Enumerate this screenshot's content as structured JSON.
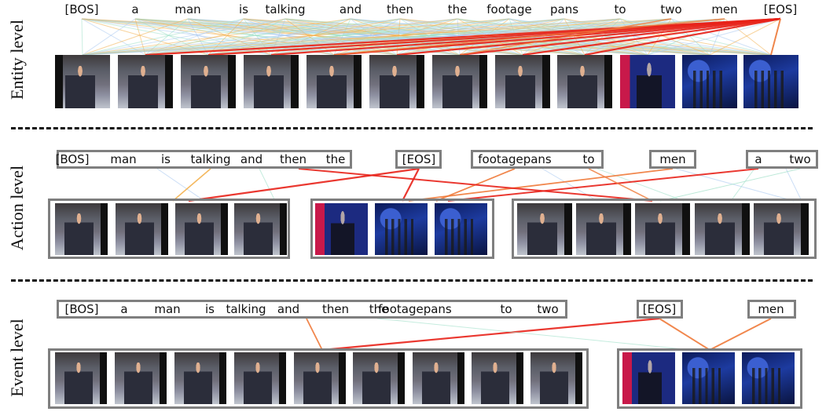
{
  "levels": {
    "entity": "Entity level",
    "action": "Action level",
    "event": "Event level"
  },
  "entity_tokens": [
    "[BOS]",
    "a",
    "man",
    "is",
    "talking",
    "and",
    "then",
    "the",
    "footage",
    "pans",
    "to",
    "two",
    "men",
    "[EOS]"
  ],
  "action_groups": [
    [
      "[BOS]",
      "man",
      "is",
      "talking",
      "and",
      "then",
      "the"
    ],
    [
      "[EOS]"
    ],
    [
      "footagepans",
      "to"
    ],
    [
      "men"
    ],
    [
      "a",
      "two"
    ]
  ],
  "event_groups": [
    [
      "[BOS]",
      "a",
      "man",
      "is",
      "talking",
      "and",
      "then",
      "the",
      "footagepans",
      "to",
      "two"
    ],
    [
      "[EOS]"
    ],
    [
      "men"
    ]
  ],
  "colors": {
    "strong": "#e8221a",
    "medium": "#ef7a3a",
    "warm": "#f3b04e",
    "light": "#9fe0c8",
    "faint": "#a9c8f0",
    "box": "#7f7f7f"
  }
}
